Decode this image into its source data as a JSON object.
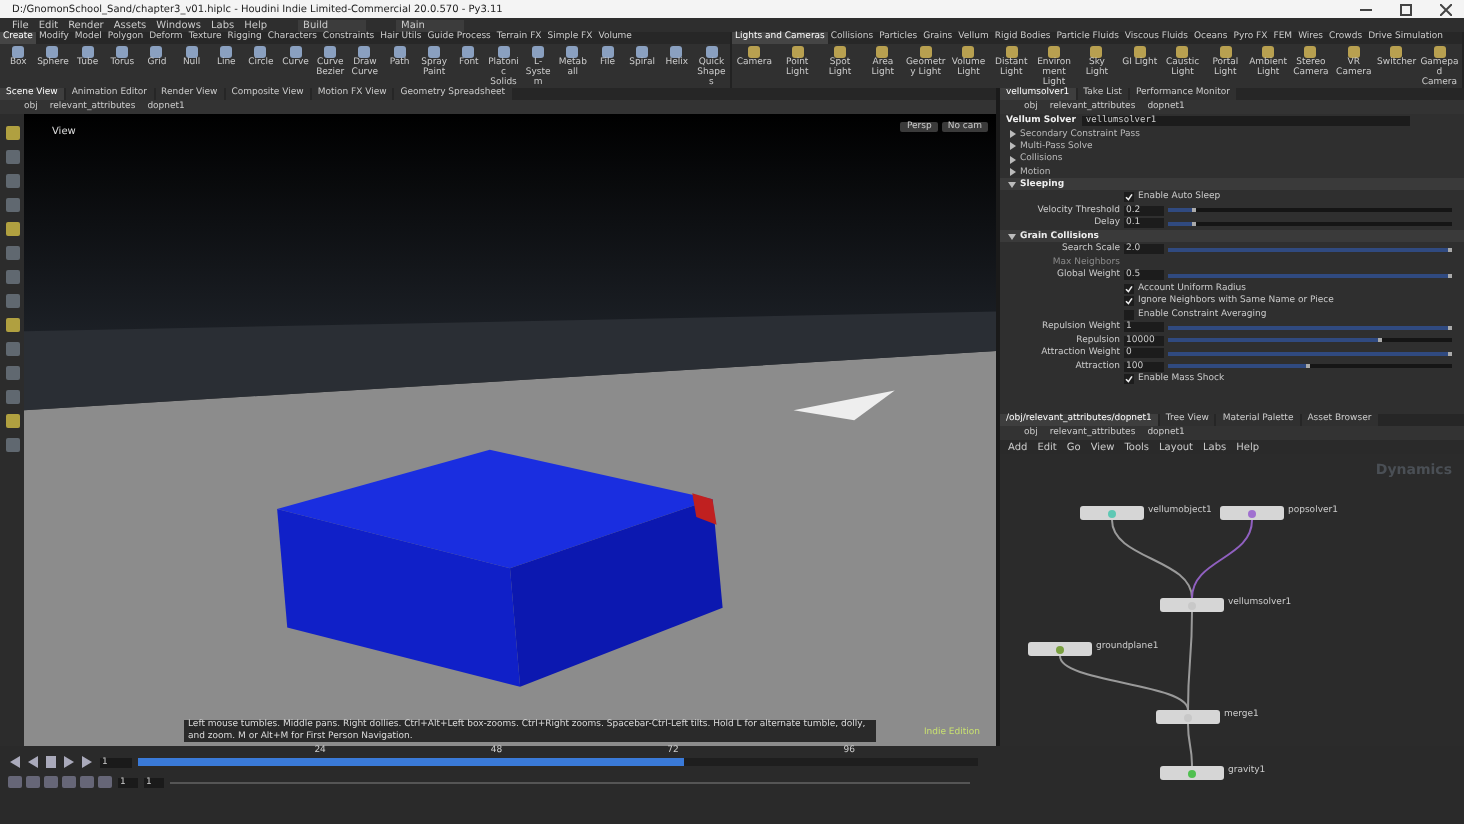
{
  "window": {
    "title": "D:/GnomonSchool_Sand/chapter3_v01.hiplc - Houdini Indie Limited-Commercial 20.0.570 - Py3.11"
  },
  "menu": [
    "File",
    "Edit",
    "Render",
    "Assets",
    "Windows",
    "Labs",
    "Help"
  ],
  "desktops": [
    {
      "label": "Build"
    },
    {
      "label": "Main"
    }
  ],
  "shelf_left": {
    "tabs": [
      {
        "label": "Create",
        "selected": true
      },
      {
        "label": "Modify",
        "selected": false
      },
      {
        "label": "Model",
        "selected": false
      },
      {
        "label": "Polygon",
        "selected": false
      },
      {
        "label": "Deform",
        "selected": false
      },
      {
        "label": "Texture",
        "selected": false
      },
      {
        "label": "Rigging",
        "selected": false
      },
      {
        "label": "Characters",
        "selected": false
      },
      {
        "label": "Constraints",
        "selected": false
      },
      {
        "label": "Hair Utils",
        "selected": false
      },
      {
        "label": "Guide Process",
        "selected": false
      },
      {
        "label": "Terrain FX",
        "selected": false
      },
      {
        "label": "Simple FX",
        "selected": false
      },
      {
        "label": "Volume",
        "selected": false
      }
    ],
    "tools": [
      "Box",
      "Sphere",
      "Tube",
      "Torus",
      "Grid",
      "Null",
      "Line",
      "Circle",
      "Curve",
      "Curve Bezier",
      "Draw Curve",
      "Path",
      "Spray Paint",
      "Font",
      "Platonic Solids",
      "L-System",
      "Metaball",
      "File",
      "Spiral",
      "Helix",
      "Quick Shapes"
    ]
  },
  "shelf_right": {
    "tabs": [
      {
        "label": "Lights and Cameras",
        "selected": true
      },
      {
        "label": "Collisions",
        "selected": false
      },
      {
        "label": "Particles",
        "selected": false
      },
      {
        "label": "Grains",
        "selected": false
      },
      {
        "label": "Vellum",
        "selected": false
      },
      {
        "label": "Rigid Bodies",
        "selected": false
      },
      {
        "label": "Particle Fluids",
        "selected": false
      },
      {
        "label": "Viscous Fluids",
        "selected": false
      },
      {
        "label": "Oceans",
        "selected": false
      },
      {
        "label": "Pyro FX",
        "selected": false
      },
      {
        "label": "FEM",
        "selected": false
      },
      {
        "label": "Wires",
        "selected": false
      },
      {
        "label": "Crowds",
        "selected": false
      },
      {
        "label": "Drive Simulation",
        "selected": false
      }
    ],
    "tools": [
      "Camera",
      "Point Light",
      "Spot Light",
      "Area Light",
      "Geometry Light",
      "Volume Light",
      "Distant Light",
      "Environment Light",
      "Sky Light",
      "GI Light",
      "Caustic Light",
      "Portal Light",
      "Ambient Light",
      "Stereo Camera",
      "VR Camera",
      "Switcher",
      "Gamepad Camera"
    ]
  },
  "left_pane": {
    "tabs": [
      {
        "label": "Scene View",
        "selected": true
      },
      {
        "label": "Animation Editor",
        "selected": false
      },
      {
        "label": "Render View",
        "selected": false
      },
      {
        "label": "Composite View",
        "selected": false
      },
      {
        "label": "Motion FX View",
        "selected": false
      },
      {
        "label": "Geometry Spreadsheet",
        "selected": false
      }
    ],
    "path": [
      "obj",
      "relevant_attributes",
      "dopnet1"
    ],
    "viewport": {
      "label": "View",
      "camera_buttons": [
        "Persp",
        "No cam"
      ],
      "hint": "Left mouse tumbles. Middle pans. Right dollies. Ctrl+Alt+Left box-zooms. Ctrl+Right zooms. Spacebar-Ctrl-Left tilts. Hold L for alternate tumble, dolly, and zoom. M or Alt+M for First Person Navigation.",
      "edition": "Indie Edition"
    }
  },
  "parameters": {
    "tabs": [
      {
        "label": "vellumsolver1",
        "selected": true
      },
      {
        "label": "Take List",
        "selected": false
      },
      {
        "label": "Performance Monitor",
        "selected": false
      }
    ],
    "path": [
      "obj",
      "relevant_attributes",
      "dopnet1"
    ],
    "node_type": "Vellum Solver",
    "node_name": "vellumsolver1",
    "sections": [
      {
        "label": "Secondary Constraint Pass",
        "expanded": false
      },
      {
        "label": "Multi-Pass Solve",
        "expanded": false
      },
      {
        "label": "Collisions",
        "expanded": false
      },
      {
        "label": "Motion",
        "expanded": false
      },
      {
        "label": "Sleeping",
        "expanded": true,
        "rows": [
          {
            "kind": "toggle",
            "label": "Enable Auto Sleep",
            "checked": true
          },
          {
            "kind": "slider",
            "label": "Velocity Threshold",
            "value": "0.2",
            "level": 0.1,
            "disabled": false
          },
          {
            "kind": "slider",
            "label": "Delay",
            "value": "0.1",
            "level": 0.1,
            "disabled": false
          }
        ]
      },
      {
        "label": "Grain Collisions",
        "expanded": true,
        "rows": [
          {
            "kind": "slider",
            "label": "Search Scale",
            "value": "2.0",
            "level": 1,
            "disabled": false
          },
          {
            "kind": "slider",
            "label": "Max Neighbors",
            "disabled": true
          },
          {
            "kind": "slider",
            "label": "Global Weight",
            "value": "0.5",
            "level": 1,
            "disabled": false
          },
          {
            "kind": "toggle",
            "label": "Account Uniform Radius",
            "checked": true
          },
          {
            "kind": "toggle",
            "label": "Ignore Neighbors with Same Name or Piece",
            "checked": true
          },
          {
            "kind": "toggle",
            "label": "Enable Constraint Averaging",
            "checked": false
          },
          {
            "kind": "slider",
            "label": "Repulsion Weight",
            "value": "1",
            "level": 1,
            "disabled": false
          },
          {
            "kind": "slider",
            "label": "Repulsion",
            "value": "10000",
            "level": 0.75,
            "disabled": false
          },
          {
            "kind": "slider",
            "label": "Attraction Weight",
            "value": "0",
            "level": 1,
            "disabled": false
          },
          {
            "kind": "slider",
            "label": "Attraction",
            "value": "100",
            "level": 0.5,
            "disabled": false
          },
          {
            "kind": "toggle",
            "label": "Enable Mass Shock",
            "checked": true
          }
        ]
      }
    ]
  },
  "network": {
    "tabs": [
      {
        "label": "/obj/relevant_attributes/dopnet1",
        "selected": true
      },
      {
        "label": "Tree View",
        "selected": false
      },
      {
        "label": "Material Palette",
        "selected": false
      },
      {
        "label": "Asset Browser",
        "selected": false
      }
    ],
    "path": [
      "obj",
      "relevant_attributes",
      "dopnet1"
    ],
    "menu": [
      "Add",
      "Edit",
      "Go",
      "View",
      "Tools",
      "Layout",
      "Labs",
      "Help"
    ],
    "context": "Dynamics",
    "nodes": [
      {
        "name": "vellumobject1",
        "color": "#5fc8b4"
      },
      {
        "name": "popsolver1",
        "color": "#a070d0"
      },
      {
        "name": "vellumsolver1",
        "color": "#c8c8c8"
      },
      {
        "name": "groundplane1",
        "color": "#7aa040"
      },
      {
        "name": "merge1",
        "color": "#c8c8c8"
      },
      {
        "name": "gravity1",
        "color": "#50c050"
      }
    ]
  },
  "timeline": {
    "frame": "1",
    "ticks": [
      "24",
      "48",
      "72",
      "96"
    ],
    "start": "1",
    "end": "1"
  }
}
